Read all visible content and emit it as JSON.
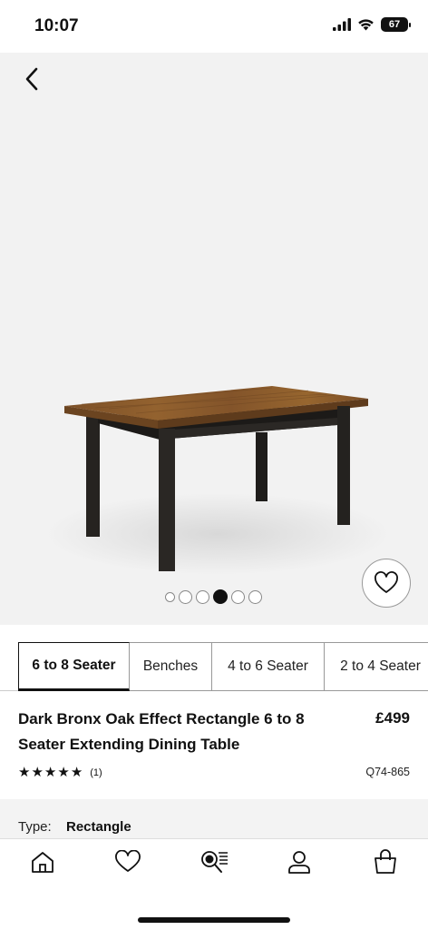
{
  "status_bar": {
    "time": "10:07",
    "battery": "67"
  },
  "gallery": {
    "dot_count": 6,
    "active_index": 3
  },
  "tabs": [
    {
      "label": "6 to 8 Seater",
      "active": true
    },
    {
      "label": "Benches",
      "active": false
    },
    {
      "label": "4 to 6 Seater",
      "active": false
    },
    {
      "label": "2 to 4 Seater",
      "active": false
    }
  ],
  "product": {
    "title_line1": "Dark Bronx Oak Effect Rectangle 6 to 8",
    "title_line2": "Seater Extending Dining Table",
    "price": "£499",
    "rating_stars": 5,
    "review_count": "(1)",
    "sku": "Q74-865"
  },
  "details": {
    "type_label": "Type:",
    "type_value": "Rectangle"
  },
  "bottom_nav": [
    {
      "name": "home",
      "icon": "home-icon"
    },
    {
      "name": "wishlist",
      "icon": "heart-icon"
    },
    {
      "name": "search",
      "icon": "search-list-icon"
    },
    {
      "name": "account",
      "icon": "user-icon"
    },
    {
      "name": "bag",
      "icon": "shopping-bag-icon"
    }
  ],
  "colors": {
    "accent": "#111111",
    "hero_bg": "#f2f2f2",
    "wood": "#8a5a2e",
    "frame": "#1f1d1b"
  }
}
